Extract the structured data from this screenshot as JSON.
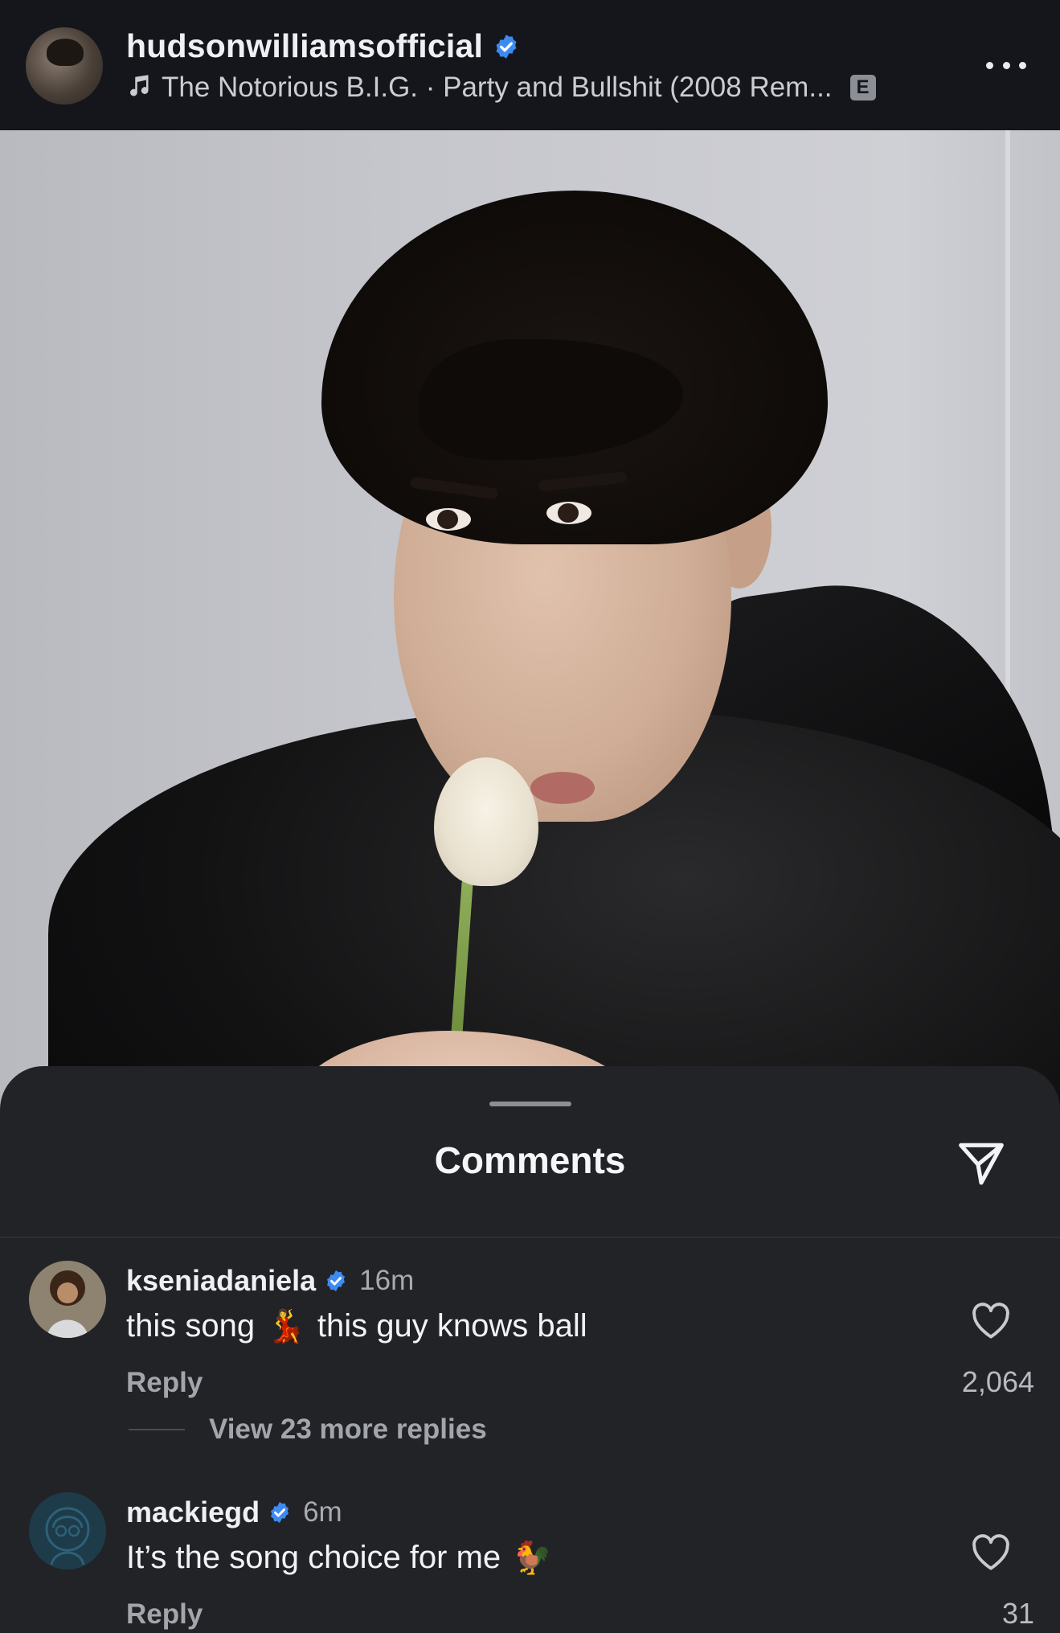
{
  "post": {
    "username": "hudsonwilliamsofficial",
    "music": "The Notorious B.I.G. · Party and Bullshit (2008 Rem...",
    "explicit": "E",
    "icons": {
      "verified": "verified-badge-icon",
      "music": "music-note-icon",
      "more": "more-options-icon"
    }
  },
  "comments_sheet": {
    "title": "Comments",
    "share_icon": "paper-plane-icon",
    "items": [
      {
        "username": "kseniadaniela",
        "verified": true,
        "time": "16m",
        "text_before": "this song",
        "emoji": "💃",
        "text_after": "this guy knows ball",
        "reply_label": "Reply",
        "like_count": "2,064",
        "view_replies": "View 23 more replies"
      },
      {
        "username": "mackiegd",
        "verified": true,
        "time": "6m",
        "text_before": "It’s the song choice for me",
        "emoji": "🐓",
        "text_after": "",
        "reply_label": "Reply",
        "like_count": "31"
      }
    ]
  },
  "colors": {
    "background": "#1f2024",
    "header": "#14161b",
    "sheet": "#222327",
    "verified": "#3d8bf2",
    "muted_text": "#a2a5ab"
  }
}
